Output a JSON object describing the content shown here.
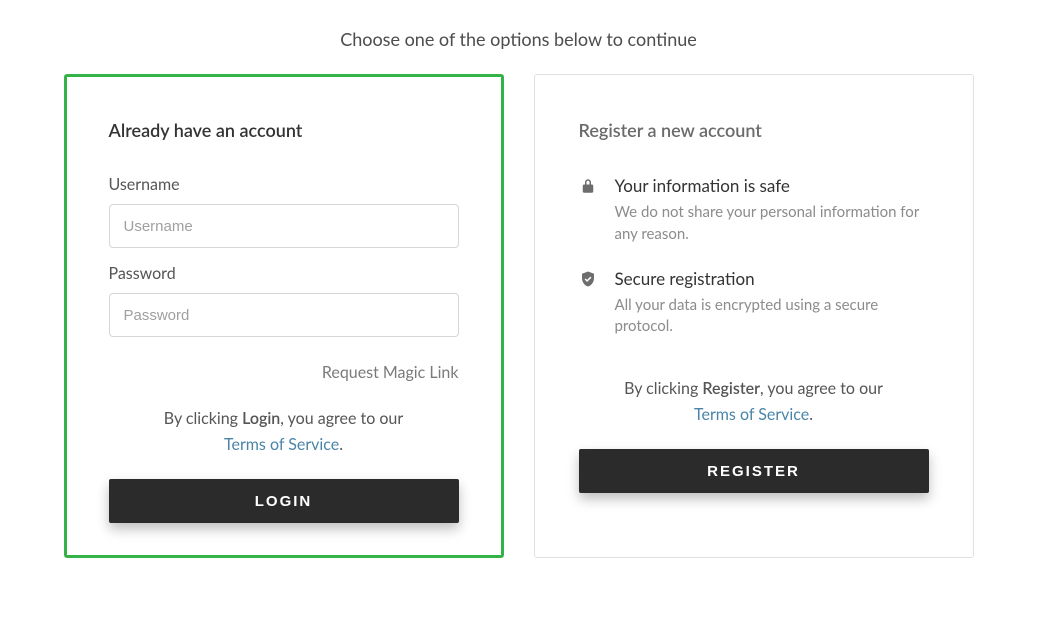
{
  "subtitle": "Choose one of the options below to continue",
  "login": {
    "heading": "Already have an account",
    "username_label": "Username",
    "username_placeholder": "Username",
    "password_label": "Password",
    "password_placeholder": "Password",
    "magic_link": "Request Magic Link",
    "agree_prefix": "By clicking ",
    "agree_action": "Login",
    "agree_suffix": ", you agree to our ",
    "tos": "Terms of Service",
    "button": "LOGIN"
  },
  "register": {
    "heading": "Register a new account",
    "safe_title": "Your information is safe",
    "safe_desc": "We do not share your personal information for any reason.",
    "secure_title": "Secure registration",
    "secure_desc": "All your data is encrypted using a secure protocol.",
    "agree_prefix": "By clicking ",
    "agree_action": "Register",
    "agree_suffix": ", you agree to our ",
    "tos": "Terms of Service",
    "button": "REGISTER"
  }
}
